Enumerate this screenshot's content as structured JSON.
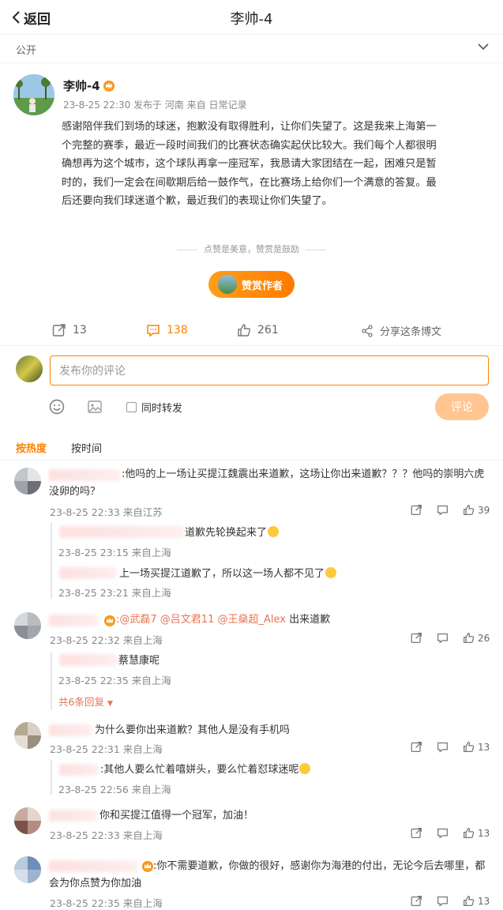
{
  "header": {
    "back_label": "返回",
    "title": "李帅-4"
  },
  "visibility": {
    "label": "公开"
  },
  "post": {
    "author": "李帅-4",
    "meta": "23-8-25 22:30 发布于 河南 来自 日常记录",
    "paragraphs": [
      "感谢陪伴我们到场的球迷，抱歉没有取得胜利，让你们失望了。这是我来上海第一",
      "个完整的赛季，最近一段时间我们的比赛状态确实起伏比较大。我们每个人都很明",
      "确想再为这个城市，这个球队再拿一座冠军，我恳请大家团结在一起，困难只是暂",
      "时的，我们一定会在间歇期后给一鼓作气，在比赛场上给你们一个满意的答复。最",
      "后还要向我们球迷道个歉，最近我们的表现让你们失望了。"
    ],
    "reward_tip": "点赞是美意，赞赏是鼓励",
    "reward_button": "赞赏作者"
  },
  "actions": {
    "reposts": "13",
    "comments": "138",
    "likes": "261",
    "share_label": "分享这条博文"
  },
  "composer": {
    "placeholder": "发布你的评论",
    "repost_label": "同时转发",
    "submit_label": "评论"
  },
  "sort": {
    "hot": "按热度",
    "time": "按时间"
  },
  "comments": [
    {
      "text_line1": ":他吗的上一场让买提江魏震出来道歉，这场让你出来道歉？？？他吗的崇明六虎",
      "text_line2": "没卵的吗？",
      "time": "23-8-25 22:33 来自江苏",
      "likes": "39",
      "replies": [
        {
          "text": "道歉先轮换起来了",
          "time": "23-8-25 23:15 来自上海"
        },
        {
          "text": "上一场买提江道歉了，所以这一场人都不见了",
          "time": "23-8-25 23:21 来自上海"
        }
      ]
    },
    {
      "mentions": [
        ":@武磊7",
        "@吕文君11",
        "@王燊超_Alex"
      ],
      "text_tail": "出来道歉",
      "time": "23-8-25 22:32 来自上海",
      "likes": "26",
      "replies": [
        {
          "text": "蔡慧康呢",
          "time": "23-8-25 22:35 来自上海"
        }
      ],
      "more_replies": "共6条回复"
    },
    {
      "text_line1": "为什么要你出来道歉？其他人是没有手机吗",
      "time": "23-8-25 22:31 来自上海",
      "likes": "13",
      "replies": [
        {
          "text": ":其他人要么忙着嘻姘头，要么忙着怼球迷呢",
          "time": "23-8-25 22:56 来自上海"
        }
      ]
    },
    {
      "text_line1": "你和买提江值得一个冠军，加油！",
      "time": "23-8-25 22:33 来自上海",
      "likes": "13"
    },
    {
      "text_line1": ":你不需要道歉，你做的很好，感谢你为海港的付出，无论今后去哪里，都",
      "text_line2": "会为你点赞为你加油",
      "time": "23-8-25 22:35 来自上海",
      "likes": "13"
    }
  ],
  "colors": {
    "accent": "#ff8200",
    "mention": "#eb7350",
    "submit_disabled": "#ffc692"
  }
}
